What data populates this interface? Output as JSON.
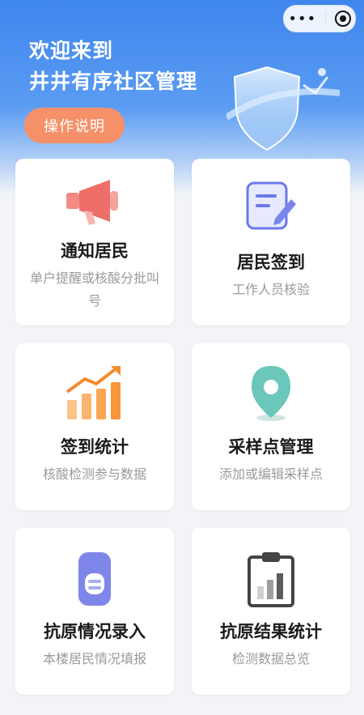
{
  "header": {
    "welcome_line1": "欢迎来到",
    "welcome_line2": "井井有序社区管理",
    "help_button": "操作说明"
  },
  "capsule": {
    "more_icon": "more-dots-icon",
    "close_icon": "target-circle-icon"
  },
  "cards": [
    {
      "title": "通知居民",
      "subtitle": "单户提醒或核酸分批叫号",
      "icon": "megaphone-icon"
    },
    {
      "title": "居民签到",
      "subtitle": "工作人员核验",
      "icon": "form-edit-icon"
    },
    {
      "title": "签到统计",
      "subtitle": "核酸检测参与数据",
      "icon": "bar-chart-trend-icon"
    },
    {
      "title": "采样点管理",
      "subtitle": "添加或编辑采样点",
      "icon": "location-pin-icon"
    },
    {
      "title": "抗原情况录入",
      "subtitle": "本楼居民情况填报",
      "icon": "antigen-test-icon"
    },
    {
      "title": "抗原结果统计",
      "subtitle": "检测数据总览",
      "icon": "clipboard-chart-icon"
    }
  ]
}
